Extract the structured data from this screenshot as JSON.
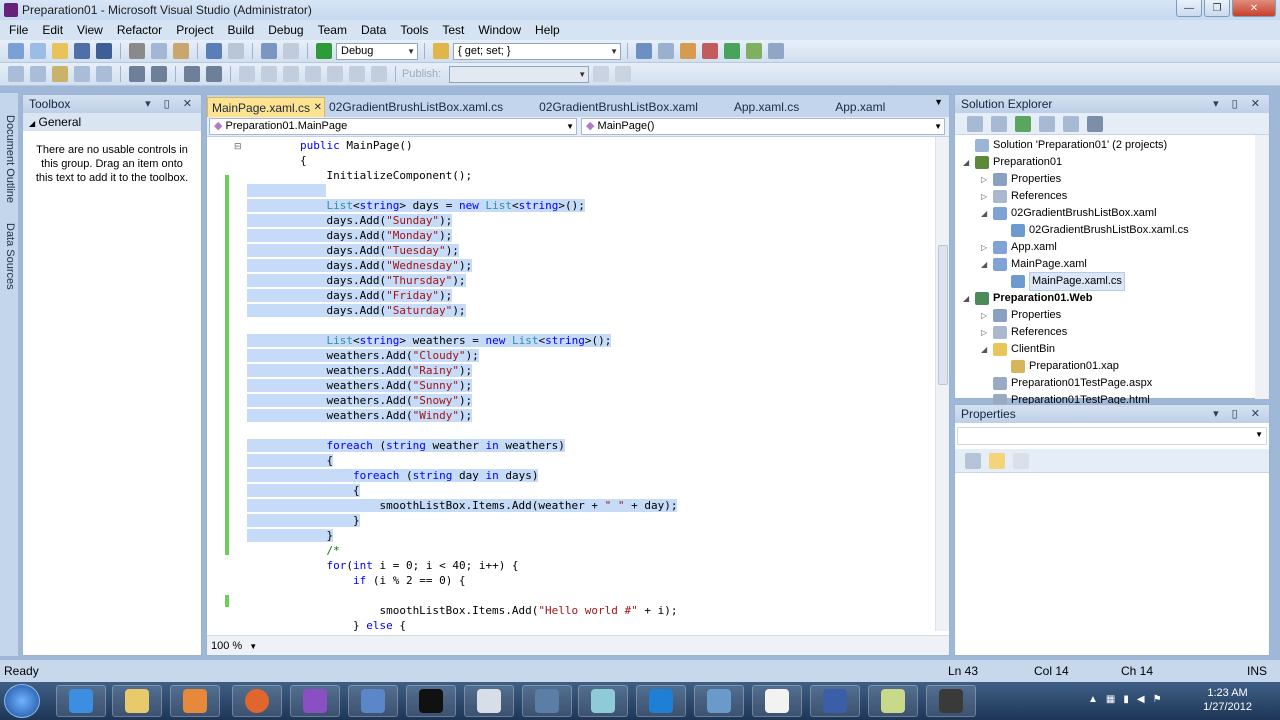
{
  "window": {
    "title": "Preparation01 - Microsoft Visual Studio (Administrator)",
    "minimize": "—",
    "maximize": "❐",
    "close": "✕"
  },
  "menu": [
    "File",
    "Edit",
    "View",
    "Refactor",
    "Project",
    "Build",
    "Debug",
    "Team",
    "Data",
    "Tools",
    "Test",
    "Window",
    "Help"
  ],
  "toolbar": {
    "config": "Debug",
    "find_value": "{ get; set; }",
    "publish_label": "Publish:"
  },
  "left_strip": {
    "doc_outline": "Document Outline",
    "data_sources": "Data Sources"
  },
  "toolbox": {
    "title": "Toolbox",
    "group": "General",
    "message": "There are no usable controls in this group. Drag an item onto this text to add it to the toolbox."
  },
  "editor": {
    "tabs": [
      {
        "label": "MainPage.xaml.cs",
        "active": true
      },
      {
        "label": "02GradientBrushListBox.xaml.cs"
      },
      {
        "label": "02GradientBrushListBox.xaml"
      },
      {
        "label": "App.xaml.cs"
      },
      {
        "label": "App.xaml"
      }
    ],
    "nav_class": "Preparation01.MainPage",
    "nav_member": "MainPage()",
    "zoom": "100 %",
    "code_lines": [
      {
        "text": "        public MainPage()"
      },
      {
        "text": "        {"
      },
      {
        "text": "            InitializeComponent();"
      },
      {
        "text": "            ",
        "sel": true
      },
      {
        "text": "            List<string> days = new List<string>();",
        "sel": true
      },
      {
        "text": "            days.Add(\"Sunday\");",
        "sel": true
      },
      {
        "text": "            days.Add(\"Monday\");",
        "sel": true
      },
      {
        "text": "            days.Add(\"Tuesday\");",
        "sel": true
      },
      {
        "text": "            days.Add(\"Wednesday\");",
        "sel": true
      },
      {
        "text": "            days.Add(\"Thursday\");",
        "sel": true
      },
      {
        "text": "            days.Add(\"Friday\");",
        "sel": true
      },
      {
        "text": "            days.Add(\"Saturday\");",
        "sel": true
      },
      {
        "text": "",
        "sel": true
      },
      {
        "text": "            List<string> weathers = new List<string>();",
        "sel": true
      },
      {
        "text": "            weathers.Add(\"Cloudy\");",
        "sel": true
      },
      {
        "text": "            weathers.Add(\"Rainy\");",
        "sel": true
      },
      {
        "text": "            weathers.Add(\"Sunny\");",
        "sel": true
      },
      {
        "text": "            weathers.Add(\"Snowy\");",
        "sel": true
      },
      {
        "text": "            weathers.Add(\"Windy\");",
        "sel": true
      },
      {
        "text": "",
        "sel": true
      },
      {
        "text": "            foreach (string weather in weathers)",
        "sel": true
      },
      {
        "text": "            {",
        "sel": true
      },
      {
        "text": "                foreach (string day in days)",
        "sel": true
      },
      {
        "text": "                {",
        "sel": true
      },
      {
        "text": "                    smoothListBox.Items.Add(weather + \" \" + day);",
        "sel": true
      },
      {
        "text": "                }",
        "sel": true
      },
      {
        "text": "            }",
        "sel": true
      },
      {
        "text": "            /*"
      },
      {
        "text": "            for(int i = 0; i < 40; i++) {"
      },
      {
        "text": "                if (i % 2 == 0) {"
      },
      {
        "text": ""
      },
      {
        "text": "                    smoothListBox.Items.Add(\"Hello world #\" + i);"
      },
      {
        "text": "                } else {"
      }
    ]
  },
  "solution_explorer": {
    "title": "Solution Explorer",
    "items": [
      {
        "label": "Solution 'Preparation01' (2 projects)",
        "icon": "solution-icon"
      },
      {
        "label": "Preparation01",
        "icon": "project-icon"
      },
      {
        "label": "Properties",
        "icon": "properties-icon"
      },
      {
        "label": "References",
        "icon": "references-icon"
      },
      {
        "label": "02GradientBrushListBox.xaml",
        "icon": "xaml-icon"
      },
      {
        "label": "02GradientBrushListBox.xaml.cs",
        "icon": "cs-file-icon"
      },
      {
        "label": "App.xaml",
        "icon": "xaml-icon"
      },
      {
        "label": "MainPage.xaml",
        "icon": "xaml-icon"
      },
      {
        "label": "MainPage.xaml.cs",
        "icon": "cs-file-icon",
        "selected": true
      },
      {
        "label": "Preparation01.Web",
        "icon": "web-project-icon",
        "bold": true
      },
      {
        "label": "Properties",
        "icon": "properties-icon"
      },
      {
        "label": "References",
        "icon": "references-icon"
      },
      {
        "label": "ClientBin",
        "icon": "folder-icon"
      },
      {
        "label": "Preparation01.xap",
        "icon": "xap-icon"
      },
      {
        "label": "Preparation01TestPage.aspx",
        "icon": "aspx-icon"
      },
      {
        "label": "Preparation01TestPage.html",
        "icon": "html-icon"
      }
    ]
  },
  "properties": {
    "title": "Properties"
  },
  "status": {
    "ready": "Ready",
    "ln": "Ln 43",
    "col": "Col 14",
    "ch": "Ch 14",
    "ins": "INS"
  },
  "taskbar": {
    "time": "1:23 AM",
    "date": "1/27/2012"
  },
  "colors": {
    "selection": "#c6dbf7",
    "keyword": "#0000ff",
    "type": "#2b91af",
    "string": "#a31515",
    "active_tab": "#fde28f",
    "change_marker": "#6dcf5b"
  }
}
